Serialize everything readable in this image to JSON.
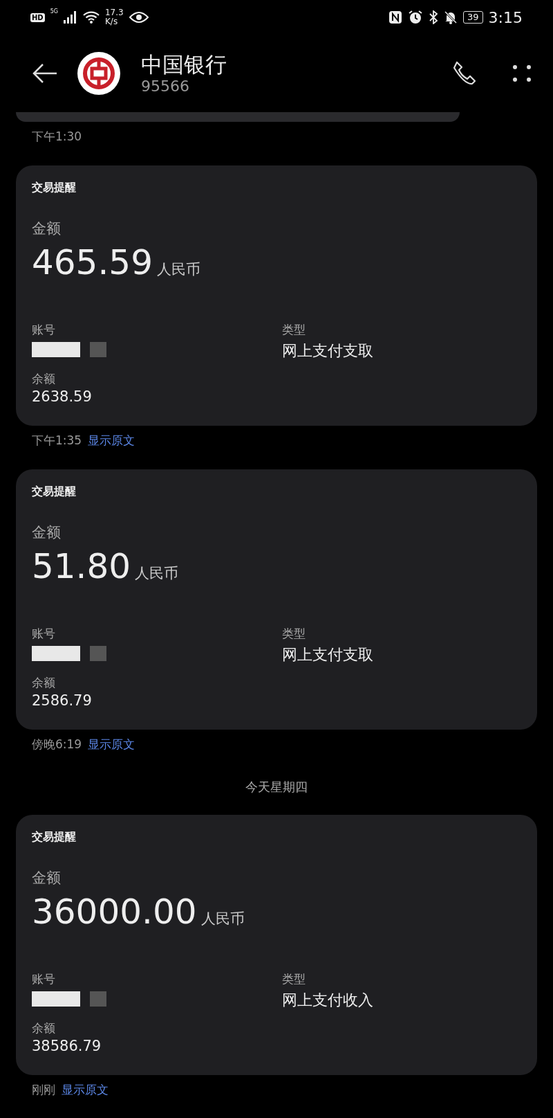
{
  "status_bar": {
    "hd": "HD",
    "network": "5G",
    "speed_value": "17.3",
    "speed_unit": "K/s",
    "battery": "39",
    "time": "3:15"
  },
  "header": {
    "title": "中国银行",
    "subtitle": "95566"
  },
  "messages": [
    {
      "kind": "partial",
      "time": "下午1:30"
    },
    {
      "kind": "card",
      "title": "交易提醒",
      "amount_label": "金额",
      "amount": "465.59",
      "currency": "人民币",
      "account_label": "账号",
      "type_label": "类型",
      "type_value": "网上支付支取",
      "balance_label": "余额",
      "balance": "2638.59",
      "time": "下午1:35",
      "link": "显示原文"
    },
    {
      "kind": "card",
      "title": "交易提醒",
      "amount_label": "金额",
      "amount": "51.80",
      "currency": "人民币",
      "account_label": "账号",
      "type_label": "类型",
      "type_value": "网上支付支取",
      "balance_label": "余额",
      "balance": "2586.79",
      "time": "傍晚6:19",
      "link": "显示原文"
    },
    {
      "kind": "date",
      "text": "今天星期四"
    },
    {
      "kind": "card",
      "title": "交易提醒",
      "amount_label": "金额",
      "amount": "36000.00",
      "currency": "人民币",
      "account_label": "账号",
      "type_label": "类型",
      "type_value": "网上支付收入",
      "balance_label": "余额",
      "balance": "38586.79",
      "time": "刚刚",
      "link": "显示原文"
    }
  ]
}
